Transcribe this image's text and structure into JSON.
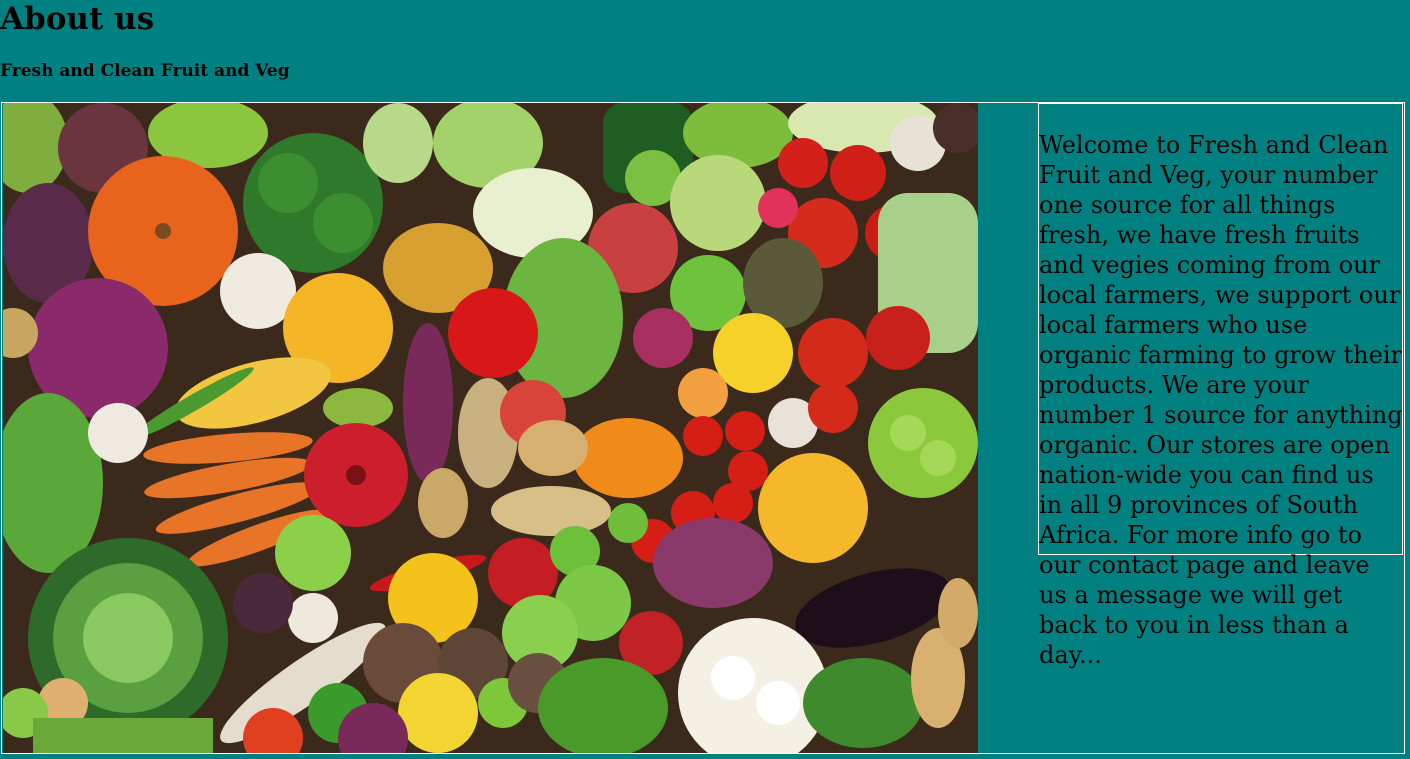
{
  "page": {
    "title": "About us",
    "subtitle": "Fresh and Clean Fruit and Veg",
    "background_color": "#008080"
  },
  "photo": {
    "icon": "fruit-and-vegetables-photo"
  },
  "about": {
    "text": "Welcome to Fresh and Clean Fruit and Veg, your number one source for all things fresh, we have fresh fruits and vegies coming from our local farmers, we support our local farmers who use organic farming to grow their products. We are your number 1 source for anything organic. Our stores are open nation-wide you can find us in all 9 provinces of South Africa. For more info go to our contact page and leave us a message we will get back to you in less than a day..."
  }
}
